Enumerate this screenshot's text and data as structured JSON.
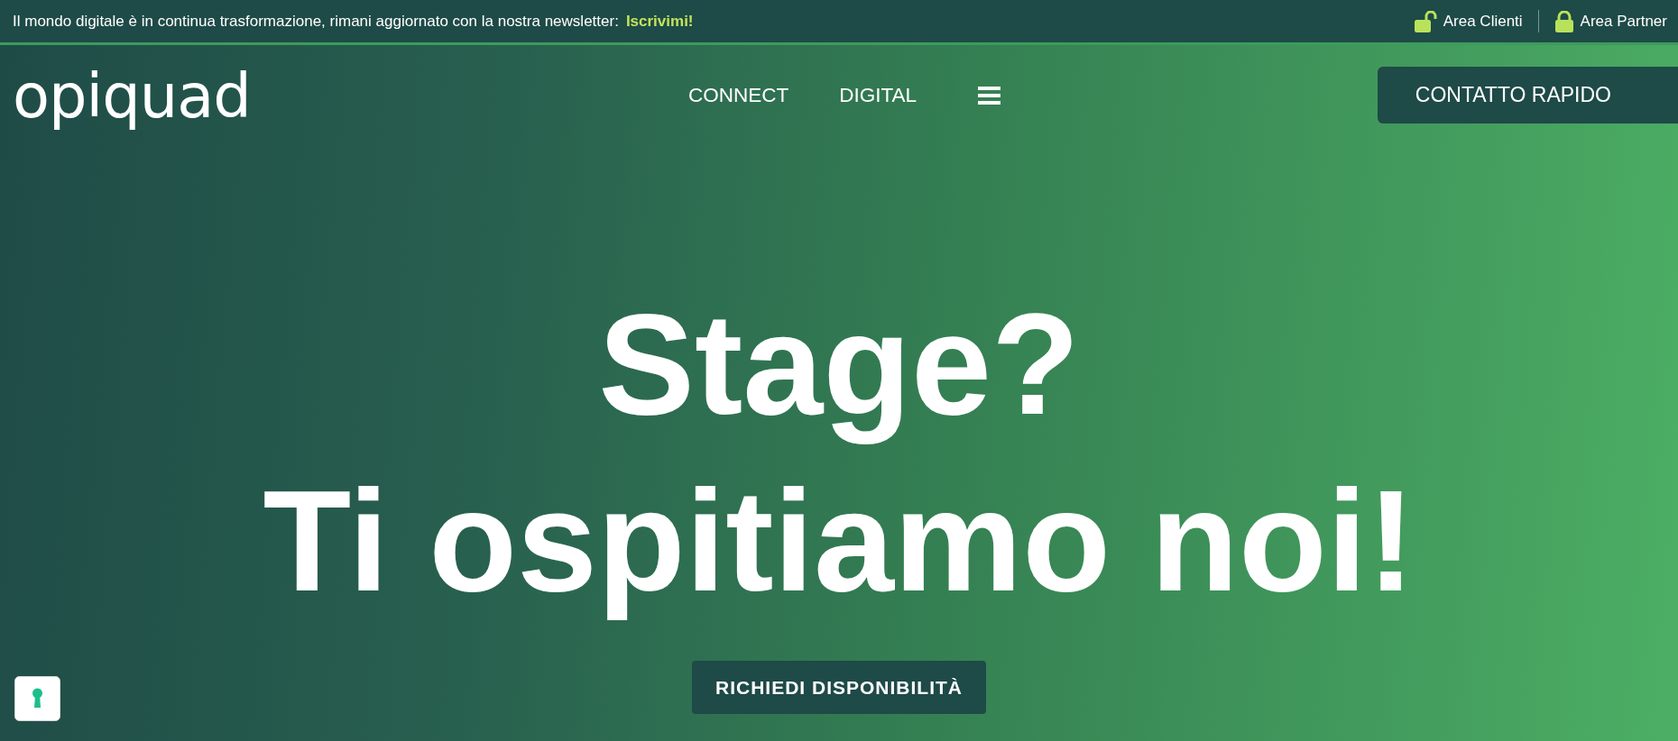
{
  "top_bar": {
    "message": "Il mondo digitale è in continua trasformazione, rimani aggiornato con la nostra newsletter:",
    "link": "Iscrivimi!",
    "areas": [
      {
        "label": "Area Clienti",
        "locked": false
      },
      {
        "label": "Area Partner",
        "locked": true
      }
    ]
  },
  "header": {
    "logo": "opiquad",
    "nav": [
      {
        "label": "CONNECT"
      },
      {
        "label": "DIGITAL"
      }
    ],
    "button": "CONTATTO RAPIDO"
  },
  "hero": {
    "lines": [
      "Stage?",
      "Ti ospitiamo noi!"
    ],
    "button": "RICHIEDI DISPONIBILITÀ"
  }
}
